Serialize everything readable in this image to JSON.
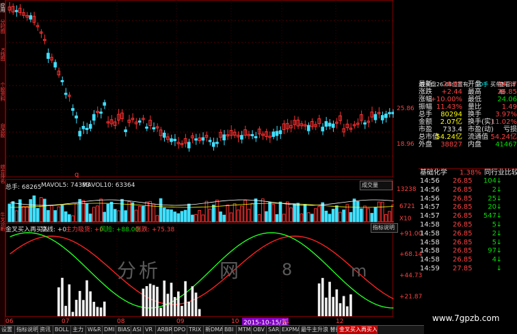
{
  "leftbar_tabs": [
    "应用",
    "分时图",
    "K线图",
    "个股资料",
    "自选股",
    "综合排名",
    "牛叉诊断"
  ],
  "price_scale": {
    "p1": "25.86",
    "p2": "18.96"
  },
  "marker_q": "q",
  "volume_header": {
    "total": "总手: 68265",
    "ma5": "MAVOL5: 74393",
    "ma10": "MAVOL10: 63364",
    "btn": "成交量"
  },
  "volume_scale": {
    "top": "13238",
    "mid": "6721",
    "unit": "X10"
  },
  "indicator_header": {
    "name": "金叉买入再买入",
    "bottom": "底线: +0",
    "main": "主力吸货: +0",
    "risk": "风险: +88.00",
    "up": "涨跌: +75.38",
    "btn": "指标说明"
  },
  "indicator_scale": [
    "+91.00",
    "+68.14",
    "+44.73",
    "+21.87"
  ],
  "watermark": {
    "w1": "分",
    "w2": "析",
    "w3": "网",
    "w4": "8",
    "w5": "m",
    "site": "www.7gpzb.com"
  },
  "date_axis": [
    "06",
    "07",
    "08",
    "09",
    "10",
    "11",
    "12"
  ],
  "date_highlight": "2015-10-15/五",
  "side_top": {
    "line1": "在买盘26.68位置有",
    "line2": "10手",
    "line3": "买单!",
    "line4": "查看详细"
  },
  "quote": [
    {
      "l1": "最新",
      "v1": "26.85",
      "l2": "开盘",
      "v2": "24.87"
    },
    {
      "l1": "涨跌",
      "v1": "+2.44",
      "l2": "最高",
      "v2": "26.85"
    },
    {
      "l1": "涨幅",
      "v1": "+10.00%",
      "l2": "最低",
      "v2": "24.06"
    },
    {
      "l1": "振幅",
      "v1": "11.43%",
      "l2": "量比",
      "v2": "1.49"
    },
    {
      "l1": "总手",
      "v1": "80294",
      "l2": "换手",
      "v2": "3.97%"
    },
    {
      "l1": "金额",
      "v1": "2.07亿",
      "l2": "换手(实)",
      "v2": "11.02%"
    },
    {
      "l1": "市盈",
      "v1": "733.4",
      "l2": "市盈(动)",
      "v2": "亏损"
    },
    {
      "l1": "总市值",
      "v1": "54.24亿",
      "l2": "流通值",
      "v2": "54.24亿"
    },
    {
      "l1": "外盘",
      "v1": "38827",
      "l2": "内盘",
      "v2": "41467"
    }
  ],
  "industry": {
    "name": "基础化学",
    "pct": "1.38%",
    "link": "同行业比较"
  },
  "trades": [
    {
      "t": "14:56",
      "p": "26.85",
      "v": "104",
      "d": "down"
    },
    {
      "t": "14:56",
      "p": "26.85",
      "v": "2",
      "d": "down"
    },
    {
      "t": "14:56",
      "p": "26.85",
      "v": "25",
      "d": "down"
    },
    {
      "t": "14:57",
      "p": "26.85",
      "v": "20",
      "d": "down"
    },
    {
      "t": "14:57",
      "p": "26.85",
      "v": "547",
      "d": "down"
    },
    {
      "t": "14:58",
      "p": "26.85",
      "v": "5",
      "d": "down"
    },
    {
      "t": "14:58",
      "p": "26.85",
      "v": "2",
      "d": "down"
    },
    {
      "t": "14:58",
      "p": "26.85",
      "v": "5",
      "d": "down"
    },
    {
      "t": "14:58",
      "p": "26.85",
      "v": "97",
      "d": "down"
    },
    {
      "t": "14:58",
      "p": "26.85",
      "v": "4",
      "d": "down"
    },
    {
      "t": "14:59",
      "p": "27.85",
      "v": "",
      "d": "down"
    }
  ],
  "bottom_tabs": [
    "设置",
    "指标说明",
    "资讯",
    "BOLL",
    "主力",
    "W&R",
    "DMI",
    "BIAS",
    "ASI",
    "VR",
    "ARBR",
    "DPO",
    "TRIX",
    "新DMA",
    "BBI",
    "MTM",
    "OBV",
    "SAR",
    "EXPMA",
    "最牛主升浪 替换",
    "金叉买入再买入"
  ]
}
